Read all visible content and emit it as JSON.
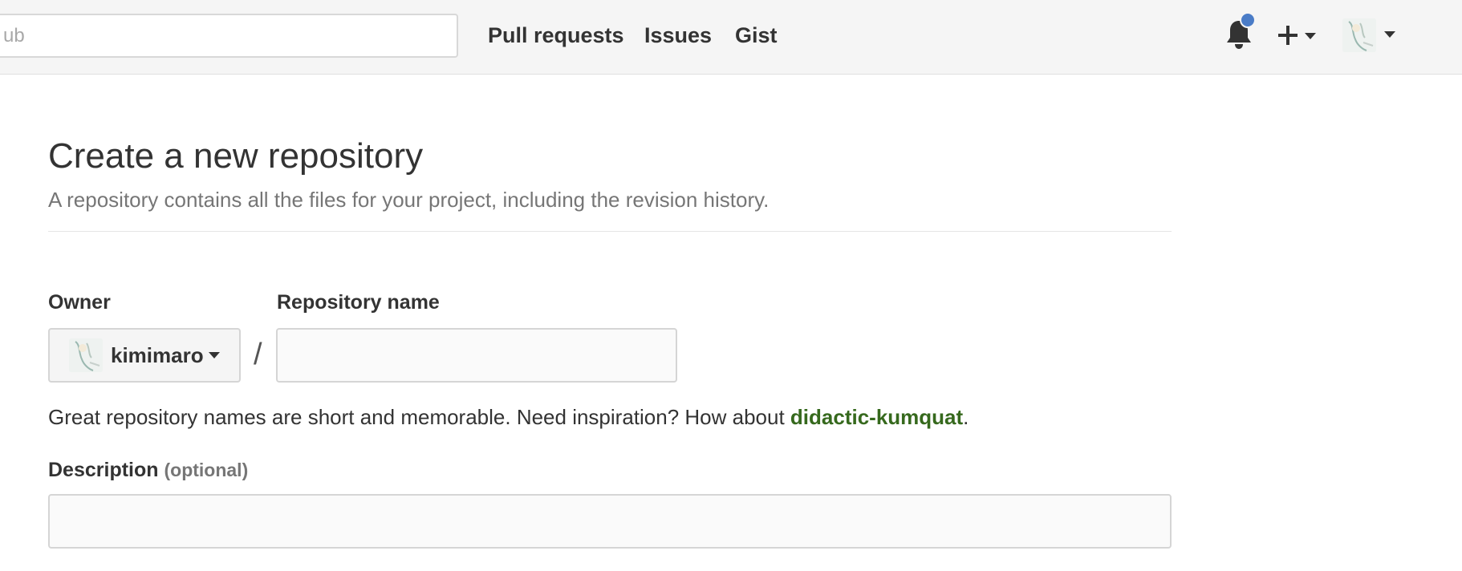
{
  "header": {
    "search": {
      "placeholder": "ub",
      "value": ""
    },
    "nav": [
      {
        "label": "Pull requests"
      },
      {
        "label": "Issues"
      },
      {
        "label": "Gist"
      }
    ],
    "notification_icon": "bell-icon",
    "has_unread_notifications": true,
    "new_menu_icon": "plus-icon",
    "user_menu_icon": "avatar"
  },
  "main": {
    "title": "Create a new repository",
    "subtitle": "A repository contains all the files for your project, including the revision history.",
    "owner": {
      "label": "Owner",
      "selected": "kimimaro"
    },
    "separator": "/",
    "repo_name": {
      "label": "Repository name",
      "value": "",
      "placeholder": ""
    },
    "hint": {
      "text": "Great repository names are short and memorable. Need inspiration? How about ",
      "suggestion": "didactic-kumquat",
      "suffix": "."
    },
    "description": {
      "label": "Description",
      "optional": "(optional)",
      "value": "",
      "placeholder": ""
    }
  },
  "colors": {
    "header_bg": "#f5f5f5",
    "notification_badge": "#4a7cc7",
    "suggestion_link": "#36691d",
    "muted_text": "#767676"
  }
}
